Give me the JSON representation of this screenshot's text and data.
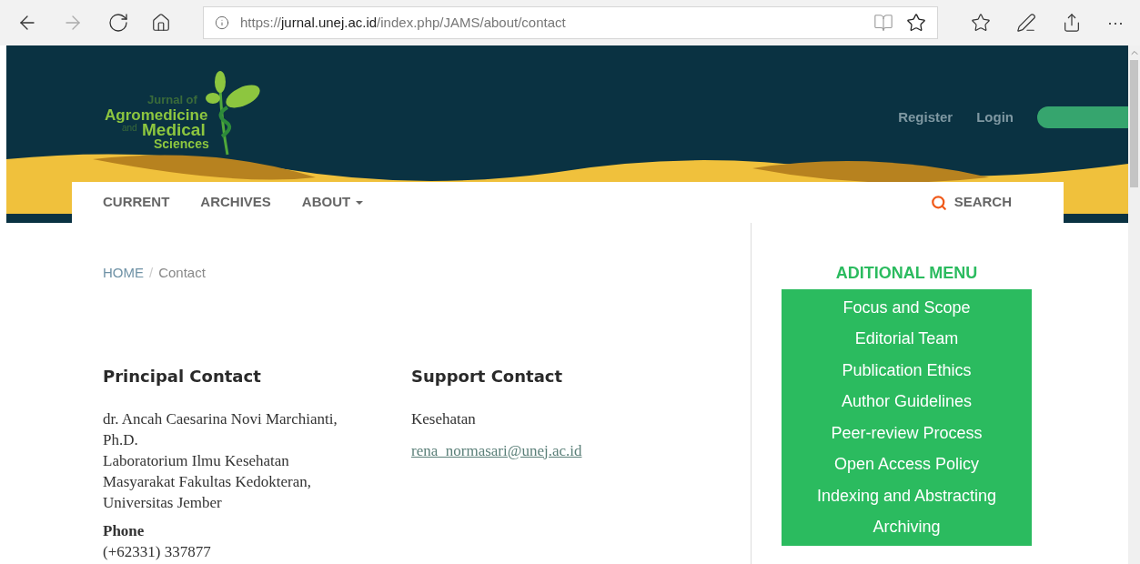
{
  "browser": {
    "url": {
      "scheme": "https://",
      "host": "jurnal.unej.ac.id",
      "path": "/index.php/JAMS/about/contact"
    },
    "more": "···"
  },
  "header": {
    "logo": {
      "line_1": "Jurnal of",
      "line_2": "Agromedicine",
      "line_3a": "and",
      "line_3b": "Medical",
      "line_4": "Sciences"
    },
    "user_links": [
      "Register",
      "Login"
    ]
  },
  "nav": {
    "items": [
      {
        "label": "CURRENT",
        "dropdown": false
      },
      {
        "label": "ARCHIVES",
        "dropdown": false
      },
      {
        "label": "ABOUT",
        "dropdown": true
      }
    ],
    "search": "SEARCH"
  },
  "breadcrumb": {
    "home": "HOME",
    "separator": "/",
    "current": "Contact"
  },
  "principal_contact": {
    "heading": "Principal Contact",
    "name": "dr. Ancah Caesarina Novi Marchianti, Ph.D.",
    "affiliation": "Laboratorium Ilmu Kesehatan Masyarakat Fakultas Kedokteran, Universitas Jember",
    "phone_label": "Phone",
    "phone": "(+62331) 337877"
  },
  "support_contact": {
    "heading": "Support Contact",
    "name": "Kesehatan",
    "email": "rena_normasari@unej.ac.id"
  },
  "sidebar": {
    "title": "ADITIONAL MENU",
    "items": [
      "Focus and Scope",
      "Editorial Team",
      "Publication Ethics",
      "Author Guidelines",
      "Peer-review Process",
      "Open Access Policy",
      "Indexing and Abstracting",
      "Archiving"
    ]
  }
}
